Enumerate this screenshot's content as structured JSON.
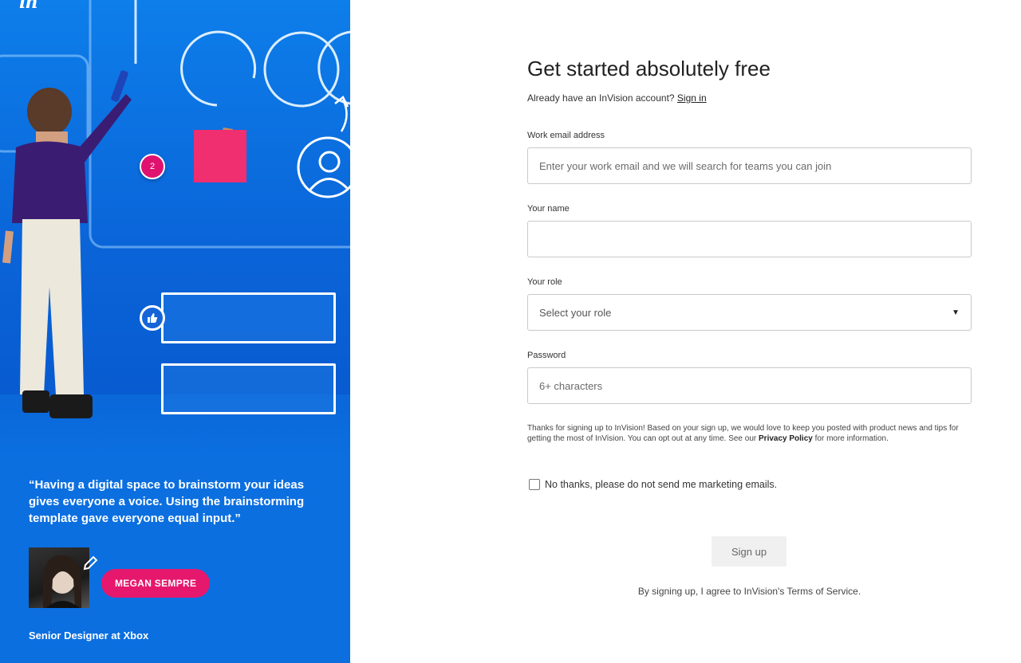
{
  "brand": {
    "logo_text": "in"
  },
  "hero": {
    "notification_count": "2"
  },
  "testimonial": {
    "quote": "“Having a digital space to brainstorm your ideas gives everyone a voice. Using the brainstorming template gave everyone equal input.”",
    "name": "MEGAN SEMPRE",
    "role": "Senior Designer at Xbox"
  },
  "form": {
    "title": "Get started absolutely free",
    "signin_prompt": "Already have an InVision account?",
    "signin_link": "Sign in",
    "email": {
      "label": "Work email address",
      "placeholder": "Enter your work email and we will search for teams you can join",
      "value": ""
    },
    "name": {
      "label": "Your name",
      "placeholder": "",
      "value": ""
    },
    "role": {
      "label": "Your role",
      "selected": "Select your role"
    },
    "password": {
      "label": "Password",
      "placeholder": "6+ characters",
      "value": ""
    },
    "disclaimer_pre": "Thanks for signing up to InVision! Based on your sign up, we would love to keep you posted with product news and tips for getting the most of InVision. You can opt out at any time. See our",
    "privacy_link": "Privacy Policy",
    "disclaimer_post": "for more information.",
    "marketing_optout": "No thanks, please do not send me marketing emails.",
    "marketing_optout_checked": false,
    "submit_label": "Sign up",
    "terms": "By signing up, I agree to InVision's Terms of Service."
  },
  "colors": {
    "panel_blue": "#0b6fe0",
    "accent_pink": "#e5186d",
    "button_bg": "#f0f0f0"
  }
}
